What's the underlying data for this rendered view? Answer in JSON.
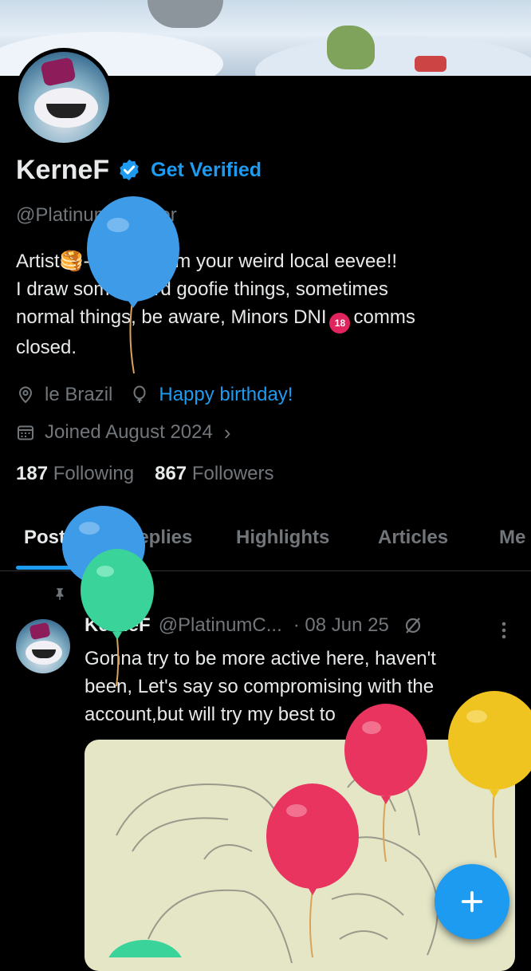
{
  "profile": {
    "display_name": "KerneF",
    "get_verified_label": "Get Verified",
    "handle": "@PlatinumCobbler",
    "bio_lines": [
      "Artist🥞- 18 - he/him  your weird local eevee!!",
      "I draw some weird goofie things, sometimes",
      "normal things, be aware, Minors DNI",
      "comms",
      "closed."
    ],
    "location": "le Brazil",
    "birthday_label": "Happy birthday!",
    "joined": "Joined August 2024",
    "following_count": "187",
    "following_label": "Following",
    "followers_count": "867",
    "followers_label": "Followers"
  },
  "tabs": [
    {
      "label": "Posts",
      "active": true
    },
    {
      "label": "Replies",
      "active": false
    },
    {
      "label": "Highlights",
      "active": false
    },
    {
      "label": "Articles",
      "active": false
    },
    {
      "label": "Me",
      "active": false
    }
  ],
  "pinned_post": {
    "pinned_label": "Pinned",
    "author_name": "KerneF",
    "author_handle": "@PlatinumC...",
    "date": "· 08 Jun 25",
    "text_lines": [
      "Gonna try to be more active here, haven't",
      "been, Let's say so compromising with the",
      "account,but will try my best to"
    ]
  },
  "icons": {
    "verified": "verified-badge-icon",
    "location": "location-pin-icon",
    "birthday": "balloon-icon",
    "calendar": "calendar-icon",
    "chevron": "chevron-right-icon",
    "pin": "pin-icon",
    "grok": "grok-icon",
    "more": "more-vertical-icon",
    "compose": "plus-icon"
  },
  "colors": {
    "accent": "#1d9bf0",
    "background": "#000000",
    "text_primary": "#e7e9ea",
    "text_secondary": "#71767b",
    "balloon_blue": "#3d9be8",
    "balloon_green": "#3ad49a",
    "balloon_red": "#e8345f",
    "balloon_yellow": "#f0c420"
  }
}
